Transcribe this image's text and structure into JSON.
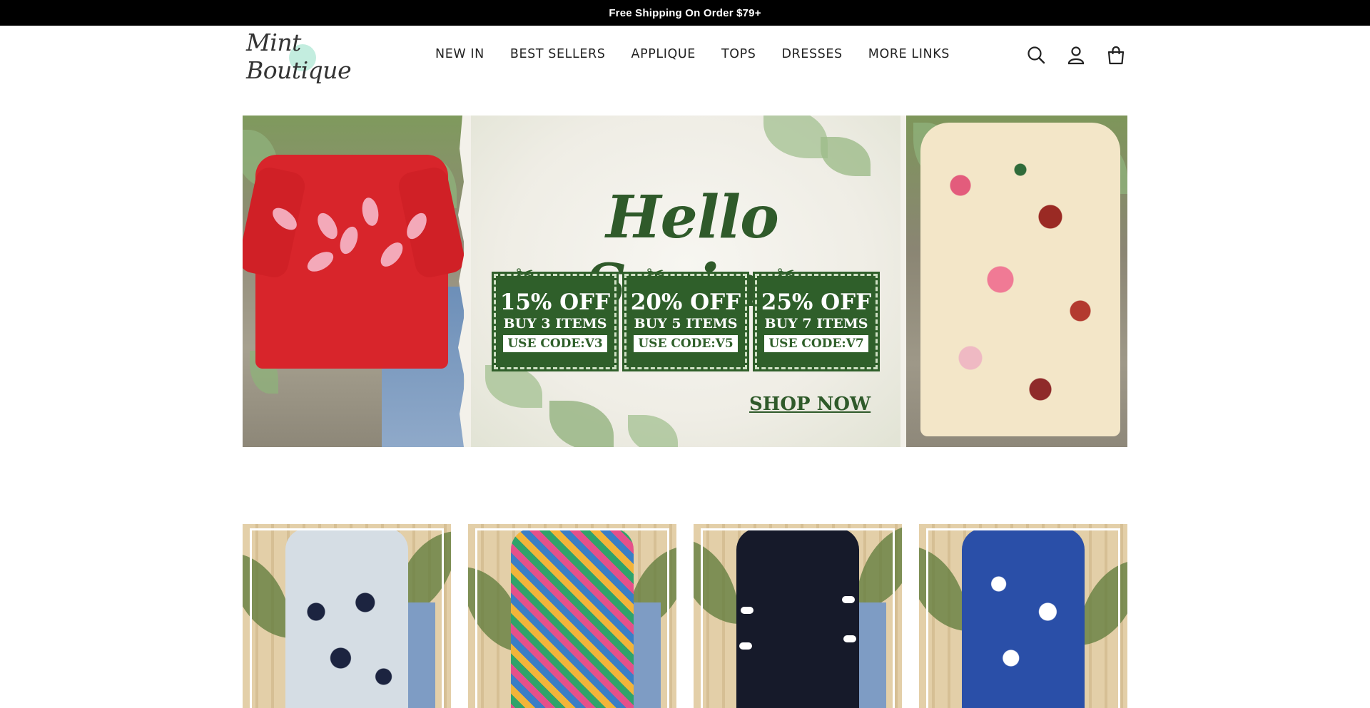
{
  "announcement": {
    "text": "Free Shipping On Order $79+"
  },
  "header": {
    "logo_text": "Mint Boutique",
    "nav": [
      {
        "label": "NEW IN"
      },
      {
        "label": "BEST SELLERS"
      },
      {
        "label": "APPLIQUE"
      },
      {
        "label": "TOPS"
      },
      {
        "label": "DRESSES"
      },
      {
        "label": "MORE LINKS"
      }
    ],
    "icons": [
      "search-icon",
      "account-icon",
      "cart-icon"
    ]
  },
  "hero": {
    "title": "Hello Spring",
    "coupons": [
      {
        "off": "15% OFF",
        "buy": "BUY 3 ITEMS",
        "code": "USE CODE:V3"
      },
      {
        "off": "20% OFF",
        "buy": "BUY 5 ITEMS",
        "code": "USE CODE:V5"
      },
      {
        "off": "25% OFF",
        "buy": "BUY 7 ITEMS",
        "code": "USE CODE:V7"
      }
    ],
    "cta": "SHOP NOW",
    "colors": {
      "accent_green": "#2f5a2a",
      "coupon_bg": "#2f5f2a"
    }
  },
  "products": [
    {
      "image": "polka-dot-ruffle-top"
    },
    {
      "image": "colorful-print-blouse"
    },
    {
      "image": "black-bow-sleeve-sweatshirt"
    },
    {
      "image": "blue-floral-dress"
    }
  ]
}
